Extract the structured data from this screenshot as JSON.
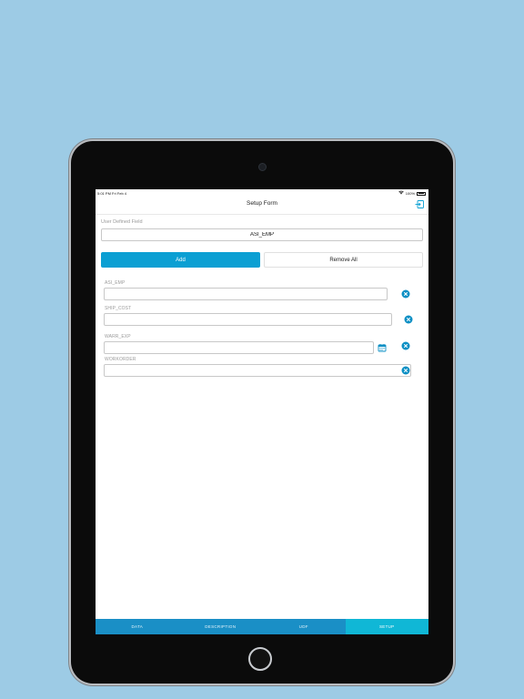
{
  "status": {
    "time": "5:01 PM   Fri Feb 4",
    "battery": "100%"
  },
  "nav": {
    "title": "Setup Form"
  },
  "form": {
    "udf_label": "User Defined Field",
    "udf_value": "ASI_EMP",
    "add_label": "Add",
    "remove_all_label": "Remove All"
  },
  "fields": [
    {
      "label": "ASI_EMP",
      "value": ""
    },
    {
      "label": "SHIP_COST",
      "value": ""
    },
    {
      "label": "WARR_EXP",
      "value": ""
    },
    {
      "label": "WORKORDER",
      "value": ""
    }
  ],
  "tabs": [
    {
      "label": "DATA"
    },
    {
      "label": "DESCRIPTION"
    },
    {
      "label": "UDF"
    },
    {
      "label": "SETUP"
    }
  ],
  "colors": {
    "accent": "#0a9fd3",
    "tab_active": "#10b7d6",
    "tabbar": "#1a8fc6",
    "background": "#9dcbe5"
  },
  "icons": [
    "logout-icon",
    "clear-icon",
    "calendar-icon",
    "wifi-icon",
    "battery-icon"
  ]
}
